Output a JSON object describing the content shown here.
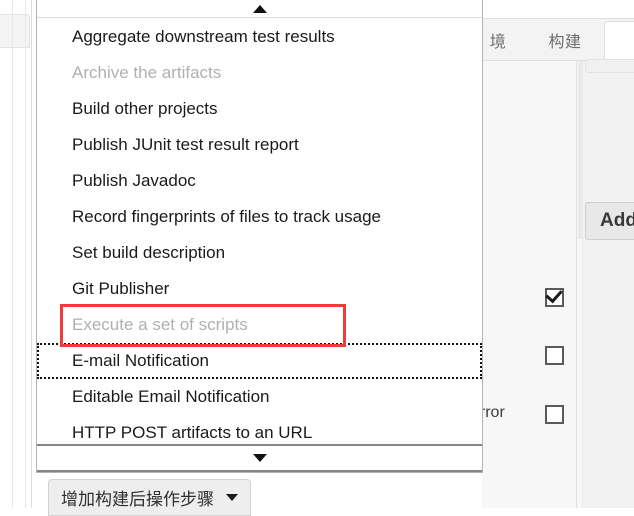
{
  "background": {
    "tabs": [
      {
        "label": "境",
        "active": false
      },
      {
        "label": "构建",
        "active": false
      },
      {
        "label": "",
        "active": true
      }
    ],
    "add_button_label": "Add",
    "error_label": "error",
    "checkboxes": [
      {
        "name": "checkbox-1",
        "checked": true
      },
      {
        "name": "checkbox-2",
        "checked": false
      },
      {
        "name": "checkbox-3",
        "checked": false
      }
    ]
  },
  "dropdown": {
    "scroll_up_icon": "triangle-up-icon",
    "scroll_down_icon": "triangle-down-icon",
    "items": [
      {
        "label": "Aggregate downstream test results",
        "disabled": false,
        "focused": false
      },
      {
        "label": "Archive the artifacts",
        "disabled": true,
        "focused": false
      },
      {
        "label": "Build other projects",
        "disabled": false,
        "focused": false
      },
      {
        "label": "Publish JUnit test result report",
        "disabled": false,
        "focused": false
      },
      {
        "label": "Publish Javadoc",
        "disabled": false,
        "focused": false
      },
      {
        "label": "Record fingerprints of files to track usage",
        "disabled": false,
        "focused": false
      },
      {
        "label": "Set build description",
        "disabled": false,
        "focused": false
      },
      {
        "label": "Git Publisher",
        "disabled": false,
        "focused": false
      },
      {
        "label": "Execute a set of scripts",
        "disabled": true,
        "focused": false
      },
      {
        "label": "E-mail Notification",
        "disabled": false,
        "focused": true
      },
      {
        "label": "Editable Email Notification",
        "disabled": false,
        "focused": false
      },
      {
        "label": "HTTP POST artifacts to an URL",
        "disabled": false,
        "focused": false
      }
    ]
  },
  "annotation": {
    "color": "#ef3b3b",
    "target_label": "Execute a set of scripts"
  },
  "footer": {
    "add_post_build_label": "增加构建后操作步骤",
    "caret_icon": "caret-down-icon"
  }
}
